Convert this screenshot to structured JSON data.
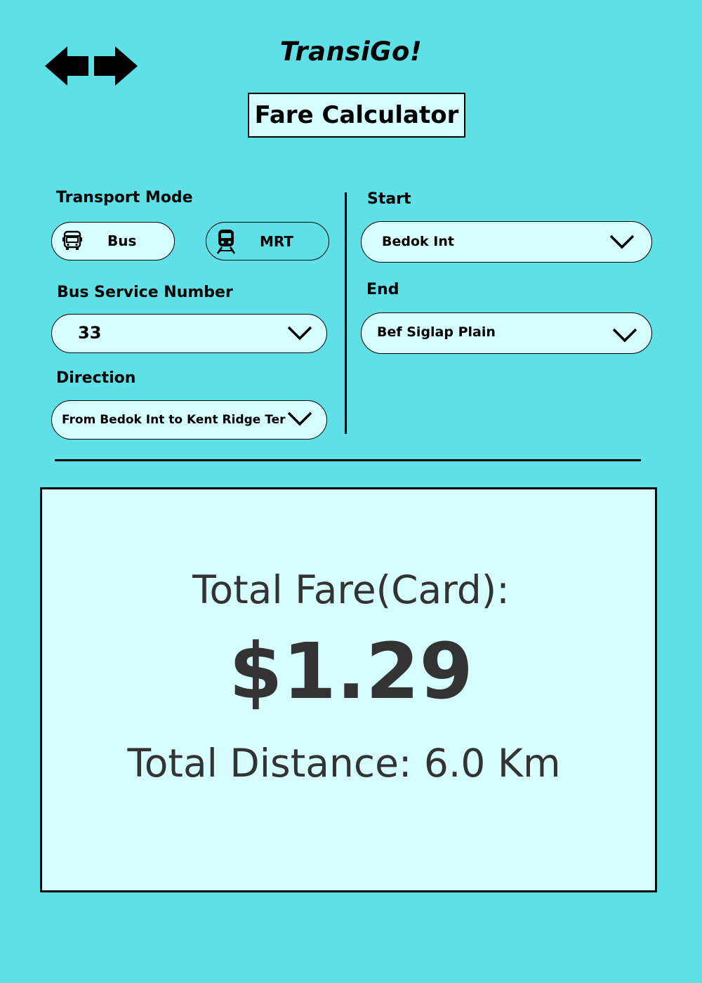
{
  "app": {
    "title": "TransiGo!"
  },
  "page": {
    "title": "Fare Calculator"
  },
  "icons": {
    "back": "arrow-left-icon",
    "forward": "arrow-right-icon",
    "bus": "bus-icon",
    "train": "train-icon",
    "dropdown": "chevron-down-icon"
  },
  "colors": {
    "background": "#5ee0e6",
    "panel": "#d6fdff",
    "text_dark": "#333333"
  },
  "form": {
    "transport_mode": {
      "label": "Transport Mode",
      "options": [
        {
          "label": "Bus",
          "selected": true
        },
        {
          "label": "MRT",
          "selected": false
        }
      ]
    },
    "bus_service": {
      "label": "Bus Service Number",
      "value": "33"
    },
    "direction": {
      "label": "Direction",
      "value": "From Bedok Int to Kent Ridge Ter"
    },
    "start": {
      "label": "Start",
      "value": "Bedok Int"
    },
    "end": {
      "label": "End",
      "value": "Bef Siglap Plain"
    }
  },
  "result": {
    "fare_label": "Total Fare(Card):",
    "fare_amount": "$1.29",
    "distance_text": "Total Distance: 6.0 Km"
  }
}
